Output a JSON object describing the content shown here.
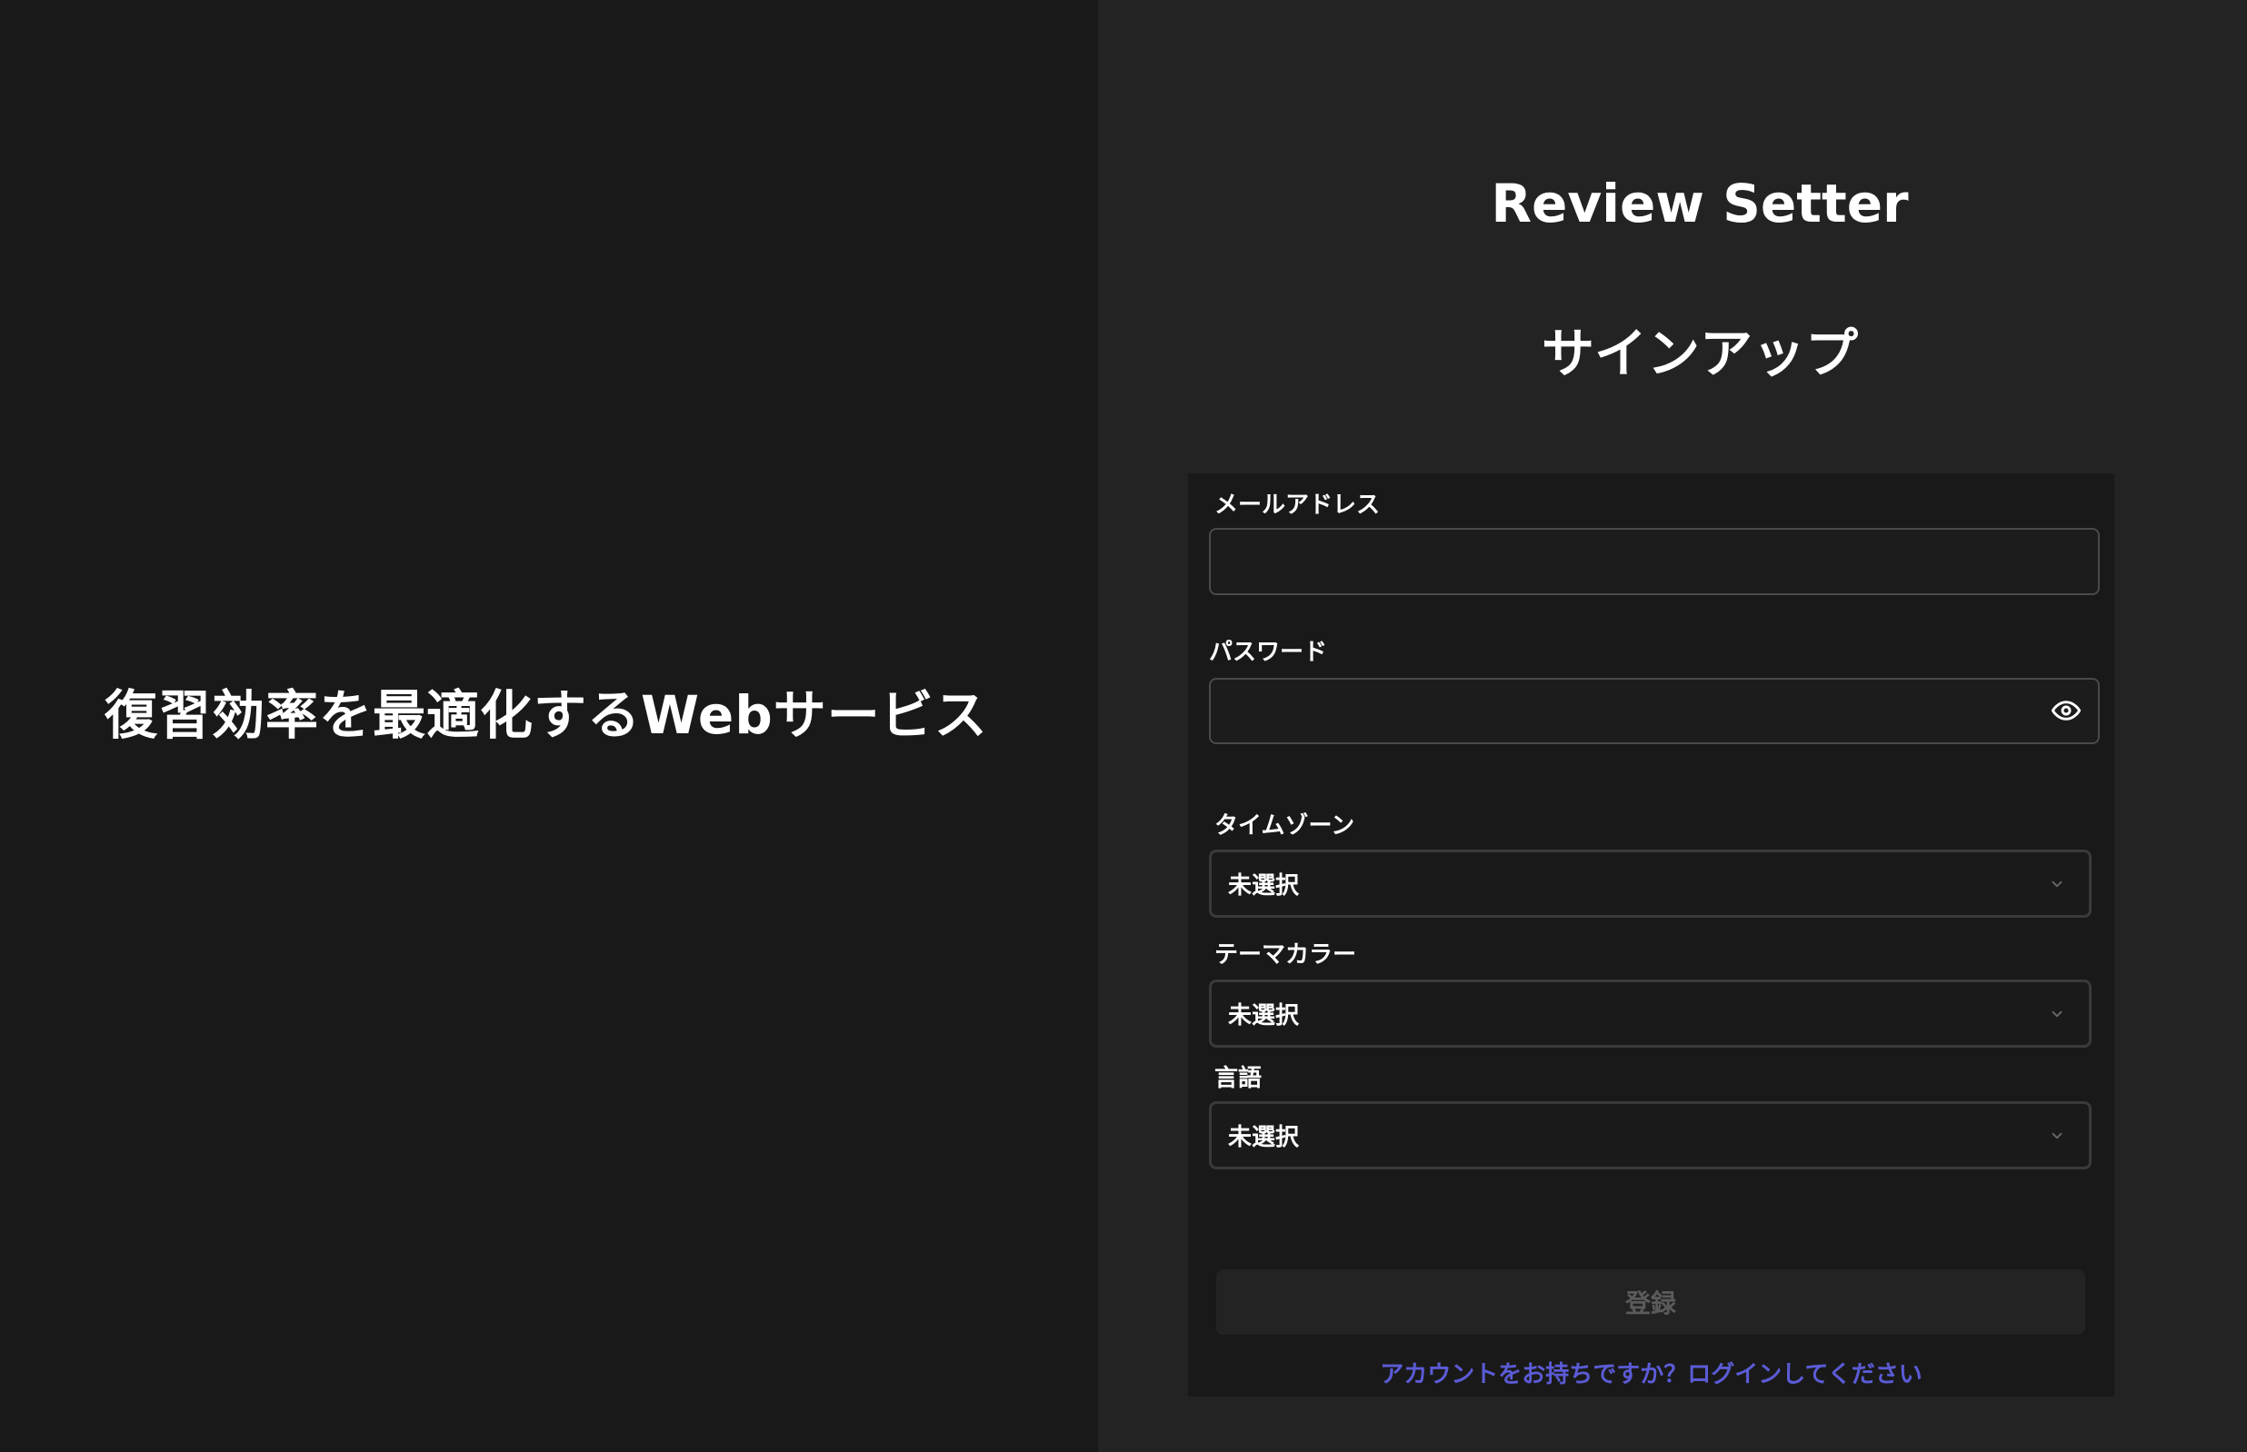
{
  "left": {
    "tagline": "復習効率を最適化するWebサービス"
  },
  "header": {
    "app_title": "Review Setter",
    "page_heading": "サインアップ"
  },
  "form": {
    "email": {
      "label": "メールアドレス",
      "value": ""
    },
    "password": {
      "label": "パスワード",
      "value": "",
      "toggle_icon": "eye-icon"
    },
    "timezone": {
      "label": "タイムゾーン",
      "selected": "未選択",
      "icon": "chevron-down-icon"
    },
    "theme_color": {
      "label": "テーマカラー",
      "selected": "未選択",
      "icon": "chevron-down-icon"
    },
    "language": {
      "label": "言語",
      "selected": "未選択",
      "icon": "chevron-down-icon"
    },
    "submit_label": "登録",
    "login_link": "アカウントをお持ちですか？ログインしてください"
  },
  "colors": {
    "left_bg": "#191919",
    "right_bg": "#232323",
    "card_bg": "#191919",
    "link": "#5b5bd6",
    "disabled_text": "#5b5b5b"
  }
}
